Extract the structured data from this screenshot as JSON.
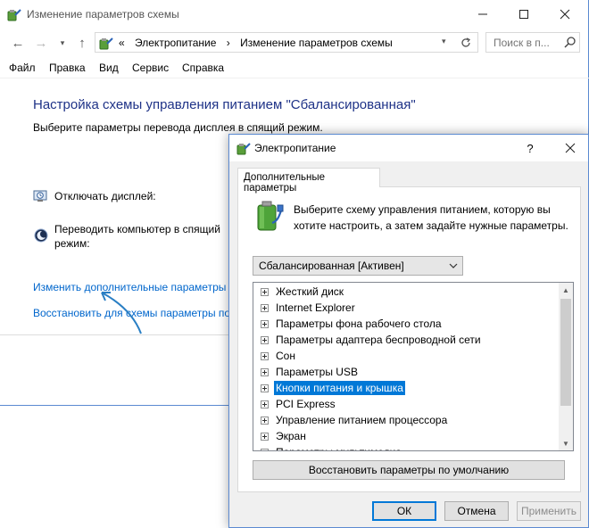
{
  "main_window": {
    "title": "Изменение параметров схемы",
    "breadcrumb": [
      "«",
      "Электропитание",
      "›",
      "Изменение параметров схемы"
    ],
    "search_placeholder": "Поиск в п...",
    "menu": [
      "Файл",
      "Правка",
      "Вид",
      "Сервис",
      "Справка"
    ],
    "heading": "Настройка схемы управления питанием \"Сбалансированная\"",
    "subheading": "Выберите параметры перевода дисплея в спящий режим.",
    "settings": {
      "display_off_label": "Отключать дисплей:",
      "sleep_label_line1": "Переводить компьютер в спящий",
      "sleep_label_line2": "режим:"
    },
    "links": {
      "advanced": "Изменить дополнительные параметры",
      "restore": "Восстановить для схемы параметры по"
    }
  },
  "dialog": {
    "title": "Электропитание",
    "help_label": "?",
    "tab_label": "Дополнительные параметры",
    "description": "Выберите схему управления питанием, которую вы хотите настроить, а затем задайте нужные параметры.",
    "scheme_select": "Сбалансированная [Активен]",
    "tree_items": [
      "Жесткий диск",
      "Internet Explorer",
      "Параметры фона рабочего стола",
      "Параметры адаптера беспроводной сети",
      "Сон",
      "Параметры USB",
      "Кнопки питания и крышка",
      "PCI Express",
      "Управление питанием процессора",
      "Экран",
      "Параметры мультимедиа"
    ],
    "selected_index": 6,
    "restore_defaults_button": "Восстановить параметры по умолчанию",
    "ok_button": "ОК",
    "cancel_button": "Отмена",
    "apply_button": "Применить"
  },
  "colors": {
    "heading": "#1e3287",
    "link": "#0066cc",
    "selection": "#0078d7",
    "arrow_annotation": "#2a7fc4"
  }
}
